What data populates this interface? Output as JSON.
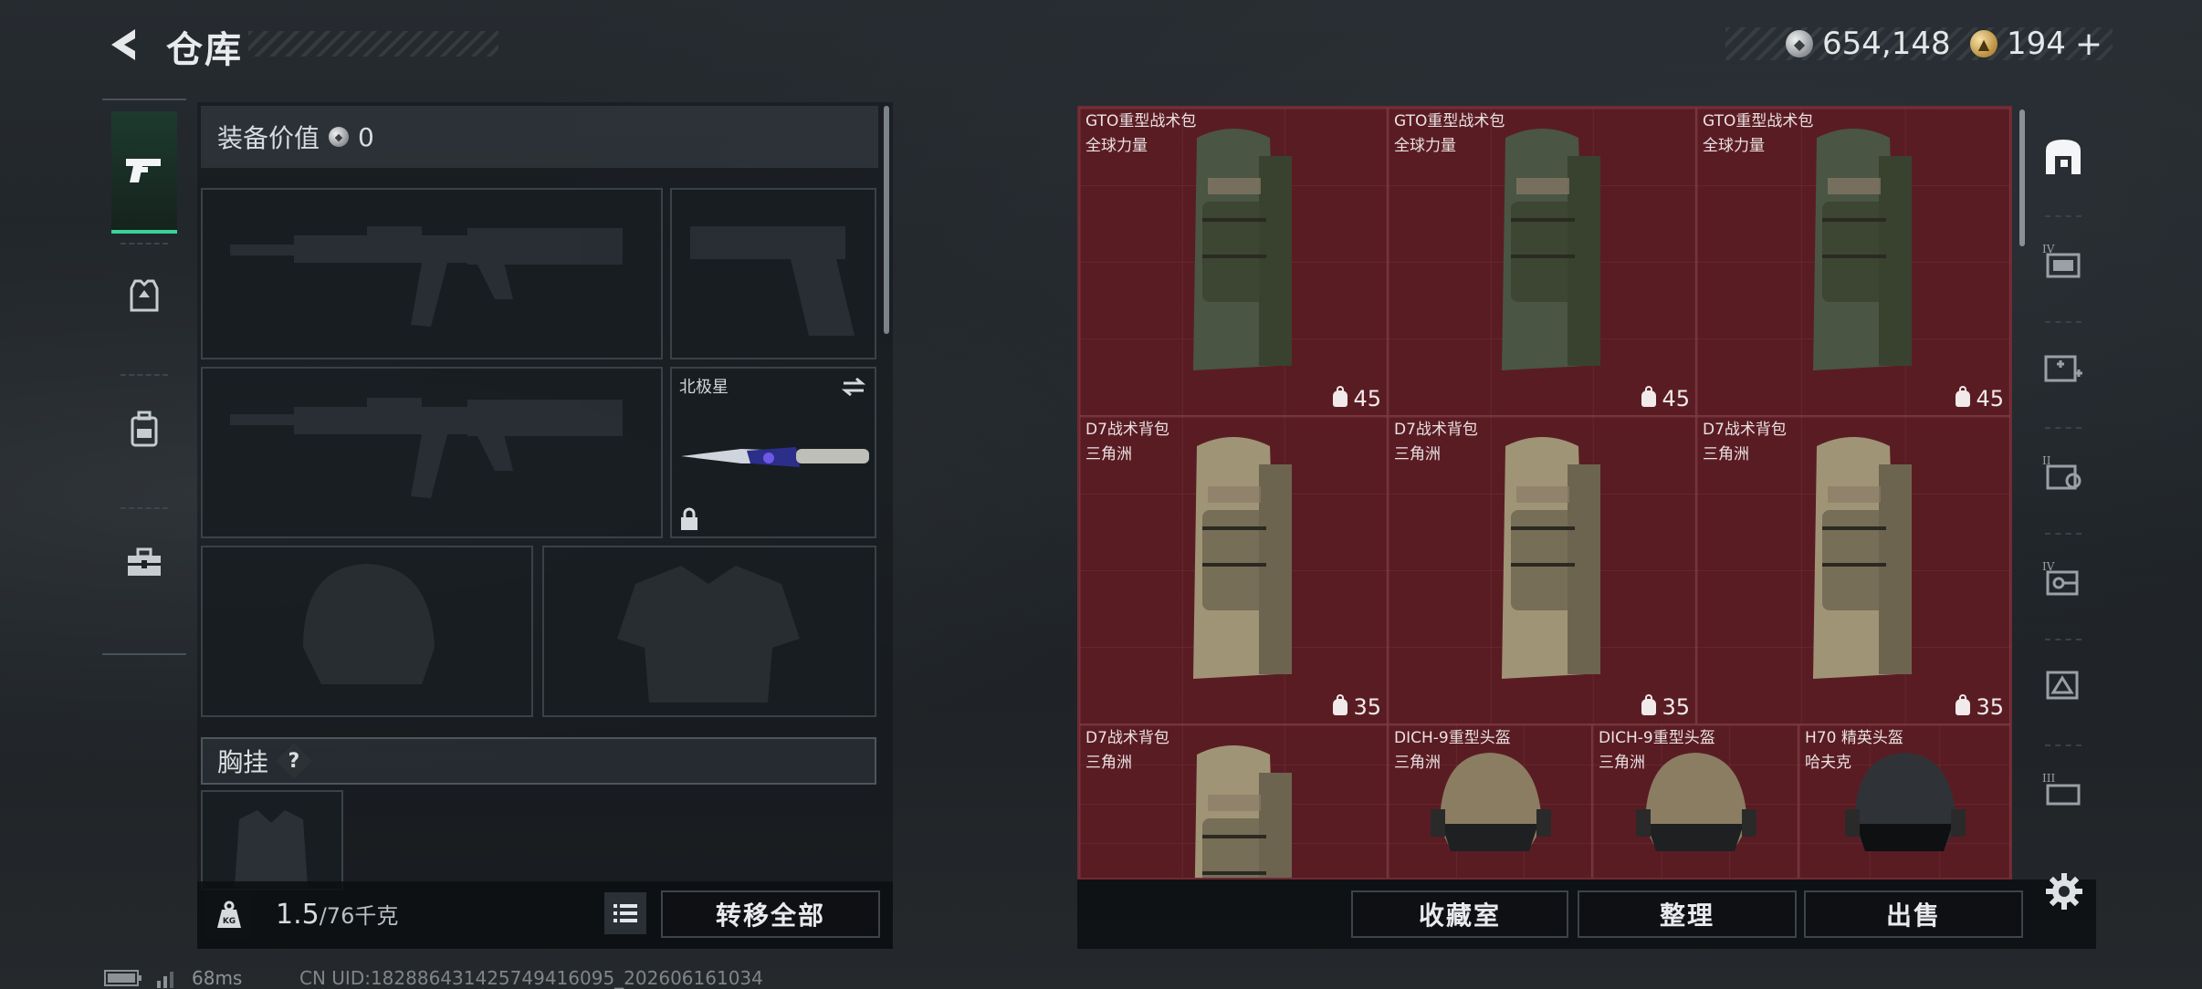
{
  "header": {
    "title": "仓库",
    "silver_amount": "654,148",
    "gold_amount": "194",
    "add_label": "+"
  },
  "equipment": {
    "value_label": "装备价值",
    "value_amount": "0",
    "melee_name": "北极星",
    "chest_label": "胸挂",
    "help_label": "?"
  },
  "capacity": {
    "current": "1.5",
    "max": "/76千克",
    "kg_badge": "KG"
  },
  "buttons": {
    "transfer_all": "转移全部",
    "collection": "收藏室",
    "organize": "整理",
    "sell": "出售"
  },
  "storage": {
    "items": [
      {
        "name": "GTO重型战术包",
        "source": "全球力量",
        "capacity": "45"
      },
      {
        "name": "GTO重型战术包",
        "source": "全球力量",
        "capacity": "45"
      },
      {
        "name": "GTO重型战术包",
        "source": "全球力量",
        "capacity": "45"
      },
      {
        "name": "D7战术背包",
        "source": "三角洲",
        "capacity": "35"
      },
      {
        "name": "D7战术背包",
        "source": "三角洲",
        "capacity": "35"
      },
      {
        "name": "D7战术背包",
        "source": "三角洲",
        "capacity": "35"
      },
      {
        "name": "D7战术背包",
        "source": "三角洲",
        "capacity": ""
      },
      {
        "name": "DICH-9重型头盔",
        "source": "三角洲",
        "capacity": ""
      },
      {
        "name": "DICH-9重型头盔",
        "source": "三角洲",
        "capacity": ""
      },
      {
        "name": "H70 精英头盔",
        "source": "哈夫克",
        "capacity": ""
      }
    ]
  },
  "filters": {
    "tier_labels": [
      "IV",
      "II",
      "IV",
      "III"
    ]
  },
  "status": {
    "ping": "68ms",
    "uid": "CN UID:18288643142574941609​5_202606161034"
  },
  "colors": {
    "accent": "#3bd398",
    "storage_bg": "#5a1c23"
  }
}
